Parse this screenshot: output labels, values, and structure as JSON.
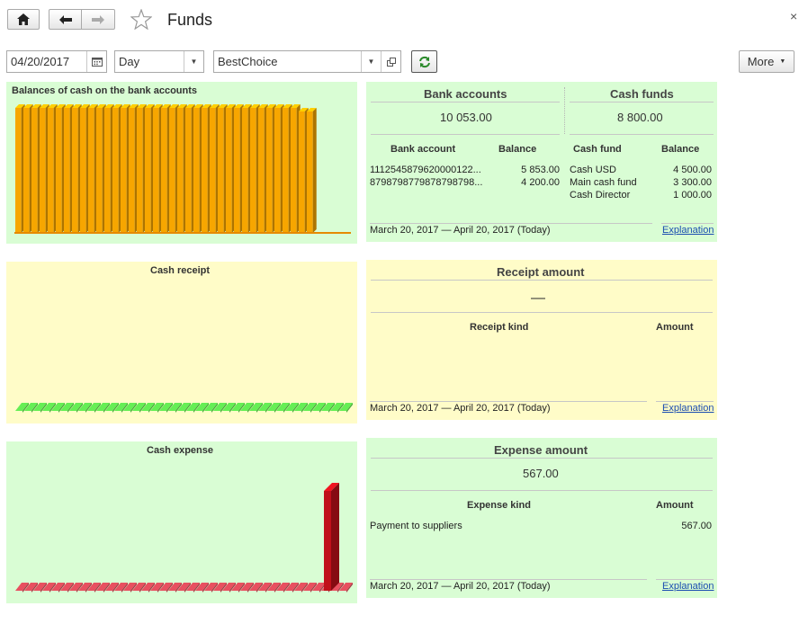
{
  "window": {
    "title": "Funds",
    "close": "×"
  },
  "toolbar": {
    "date": "04/20/2017",
    "period": "Day",
    "company": "BestChoice",
    "more": "More"
  },
  "balances_chart": {
    "title": "Balances of cash on the bank accounts",
    "bar_color": "#f7a600",
    "bar_count": 37
  },
  "bank_summary": {
    "bank_header": "Bank accounts",
    "bank_total": "10 053.00",
    "cash_header": "Cash funds",
    "cash_total": "8 800.00",
    "bank_col1": "Bank account",
    "bank_col2": "Balance",
    "cash_col1": "Cash fund",
    "cash_col2": "Balance",
    "bank_rows": [
      {
        "name": "1112545879620000122...",
        "balance": "5 853.00"
      },
      {
        "name": "8798798779878798798...",
        "balance": "4 200.00"
      }
    ],
    "cash_rows": [
      {
        "name": "Cash USD",
        "balance": "4 500.00"
      },
      {
        "name": "Main cash fund",
        "balance": "3 300.00"
      },
      {
        "name": "Cash Director",
        "balance": "1 000.00"
      }
    ],
    "period": "March 20, 2017 — April 20, 2017 (Today)",
    "explanation": "Explanation"
  },
  "receipt_chart": {
    "title": "Cash receipt",
    "bar_color": "#66ee55"
  },
  "receipt_summary": {
    "header": "Receipt amount",
    "total": "—",
    "col1": "Receipt kind",
    "col2": "Amount",
    "period": "March 20, 2017 — April 20, 2017 (Today)",
    "explanation": "Explanation"
  },
  "expense_chart": {
    "title": "Cash expense",
    "bar_color": "#e85060",
    "tall_bar_color": "#c0101a"
  },
  "expense_summary": {
    "header": "Expense amount",
    "total": "567.00",
    "col1": "Expense kind",
    "col2": "Amount",
    "rows": [
      {
        "kind": "Payment to suppliers",
        "amount": "567.00"
      }
    ],
    "period": "March 20, 2017 — April 20, 2017 (Today)",
    "explanation": "Explanation"
  }
}
